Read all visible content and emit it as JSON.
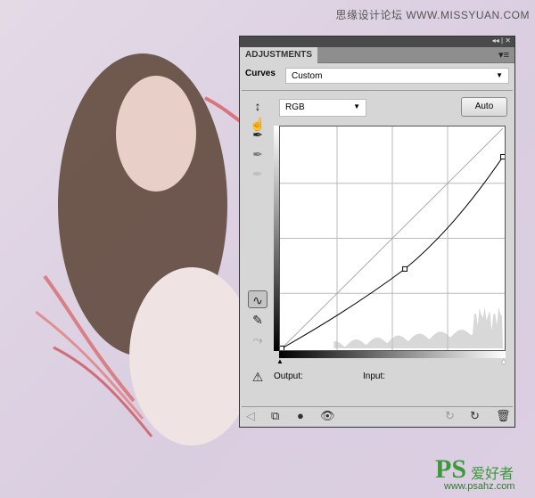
{
  "watermark": {
    "top": "思缘设计论坛  WWW.MISSYUAN.COM",
    "logo_ps": "PS",
    "logo_cn": "爱好者",
    "logo_url": "www.psahz.com"
  },
  "panel": {
    "tab": "ADJUSTMENTS",
    "adjustment_label": "Curves",
    "preset": "Custom",
    "channel": "RGB",
    "auto_label": "Auto",
    "output_label": "Output:",
    "input_label": "Input:"
  },
  "chart_data": {
    "type": "line",
    "xlim": [
      0,
      255
    ],
    "ylim": [
      0,
      255
    ],
    "grid": true,
    "series": [
      {
        "x": [
          0,
          142,
          255
        ],
        "y": [
          0,
          92,
          222
        ]
      }
    ],
    "baseline": {
      "x": [
        0,
        255
      ],
      "y": [
        0,
        255
      ]
    }
  },
  "colors": {
    "background": "#dcd0e0",
    "panel": "#d6d6d6",
    "logo": "#3a9a3a"
  }
}
